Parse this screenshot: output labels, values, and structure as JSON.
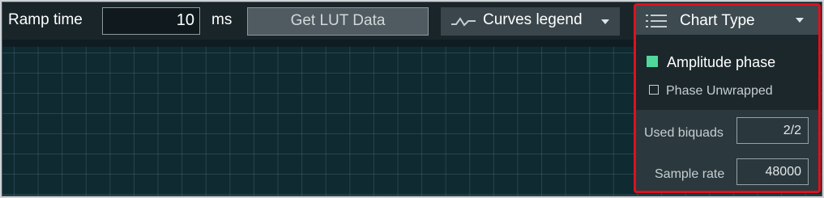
{
  "toolbar": {
    "ramp_label": "Ramp time",
    "ramp_value": "10",
    "ramp_unit": "ms",
    "lut_button": "Get LUT Data",
    "legend_button": "Curves legend"
  },
  "chart_panel": {
    "title": "Chart Type",
    "options": [
      {
        "label": "Amplitude phase",
        "checked": true
      },
      {
        "label": "Phase Unwrapped",
        "checked": false
      }
    ],
    "used_biquads_label": "Used biquads",
    "used_biquads_value": "2/2",
    "sample_rate_label": "Sample rate",
    "sample_rate_value": "48000"
  },
  "colors": {
    "highlight": "#e0101e",
    "checked": "#4fd89a",
    "plot_bg": "#0f2a30"
  },
  "icons": [
    "wave-icon",
    "list-menu-icon",
    "chevron-down-icon"
  ]
}
